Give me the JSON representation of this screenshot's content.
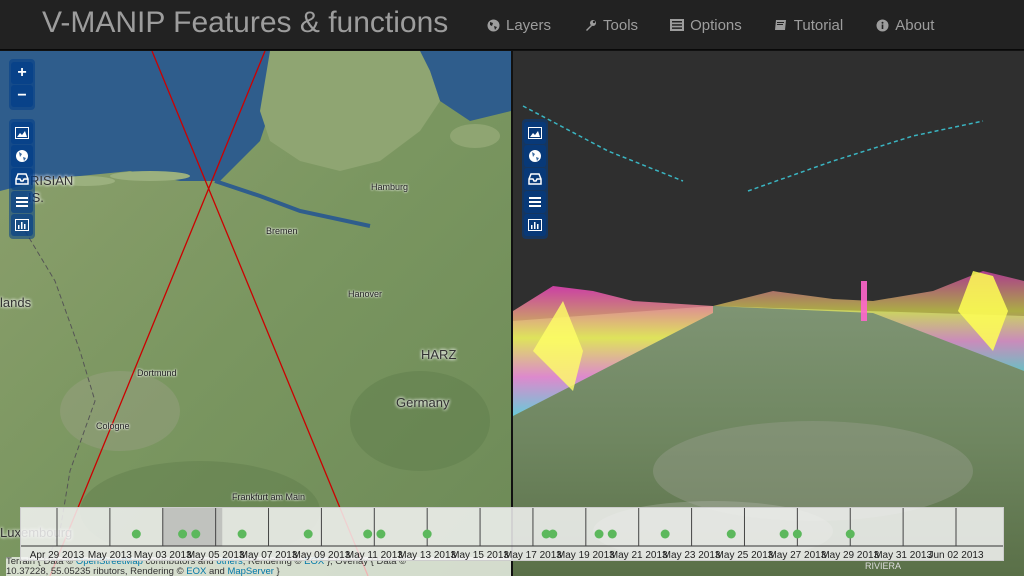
{
  "brand": "V-MANIP Features & functions",
  "nav": [
    {
      "label": "Layers",
      "icon": "globe-icon"
    },
    {
      "label": "Tools",
      "icon": "wrench-icon"
    },
    {
      "label": "Options",
      "icon": "list-icon"
    },
    {
      "label": "Tutorial",
      "icon": "book-icon"
    },
    {
      "label": "About",
      "icon": "info-icon"
    }
  ],
  "map_labels": {
    "frisian1": "FRISIAN",
    "frisian2": "IS.",
    "hamburg": "Hamburg",
    "bremen": "Bremen",
    "hanover": "Hanover",
    "lands": "lands",
    "dortmund": "Dortmund",
    "harz": "HARZ",
    "germany": "Germany",
    "cologne": "Cologne",
    "frankfurt": "Frankfurt am Main",
    "luxembourg": "Luxembourg",
    "riviera": "RIVIERA"
  },
  "controls_left": [
    "zoom-in",
    "zoom-out",
    "image",
    "globe",
    "inbox",
    "layers",
    "chart"
  ],
  "zoom_in_label": "+",
  "zoom_out_label": "−",
  "attribution": {
    "line1_pre": "Terrain { Data © ",
    "line1_link1": "OpenStreetMap",
    "line1_mid": " contributors and ",
    "line1_link2": "others",
    "line1_mid2": ", Rendering © ",
    "line1_link3": "EOX",
    "line1_post": " }, Overlay { Data ©",
    "line2_pre": "10.37228, 55.05235 ",
    "line2_mid": "ributors, Rendering © ",
    "line2_link1": "EOX",
    "line2_and": " and ",
    "line2_link2": "MapServer",
    "line2_post": " }"
  },
  "timeline": {
    "ticks": [
      "Apr 29 2013",
      "May 01 2013",
      "May 03 2013",
      "May 05 2013",
      "May 07 2013",
      "May 09 2013",
      "May 11 2013",
      "May 13 2013",
      "May 15 2013",
      "May 17 2013",
      "May 19 2013",
      "May 21 2013",
      "May 23 2013",
      "May 25 2013",
      "May 27 2013",
      "May 29 2013",
      "May 31 2013",
      "Jun 02 2013"
    ],
    "tick_texts": [
      "Apr 29 2013",
      "May 2013",
      "May 03 2013",
      "May 05 2013",
      "May 07 2013",
      "May 09 2013",
      "May 11 2013",
      "May 13 2013",
      "May 15 2013",
      "May 17 2013",
      "May 19 2013",
      "May 21 2013",
      "May 23 2013",
      "May 25 2013",
      "May 27 2013",
      "May 29 2013",
      "May 31 2013",
      "Jun 02 2013"
    ],
    "events": [
      "May 02 2013",
      "May 03 2013 18:00",
      "May 04 2013 06:00",
      "May 06 2013",
      "May 08 2013 12:00",
      "May 10 2013 18:00",
      "May 11 2013 06:00",
      "May 13 2013",
      "May 17 2013 12:00",
      "May 17 2013 18:00",
      "May 19 2013 12:00",
      "May 20 2013",
      "May 22 2013",
      "May 24 2013 12:00",
      "May 26 2013 12:00",
      "May 27 2013",
      "May 29 2013"
    ],
    "selection": {
      "start": "May 03 2013",
      "end": "May 05 2013 06:00"
    },
    "dot_color": "#5cb85c"
  }
}
